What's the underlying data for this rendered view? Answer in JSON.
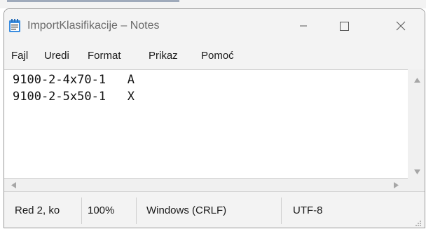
{
  "window": {
    "title": "ImportKlasifikacije – Notes"
  },
  "menu": [
    "Fajl",
    "Uredi",
    "Format",
    "Prikaz",
    "Pomoć"
  ],
  "editor": {
    "lines": [
      "9100-2-4x70-1   A",
      "9100-2-5x50-1   X"
    ]
  },
  "status": {
    "position": "Red 2, ko",
    "zoom": "100%",
    "line_ending": "Windows (CRLF)",
    "encoding": "UTF-8"
  }
}
